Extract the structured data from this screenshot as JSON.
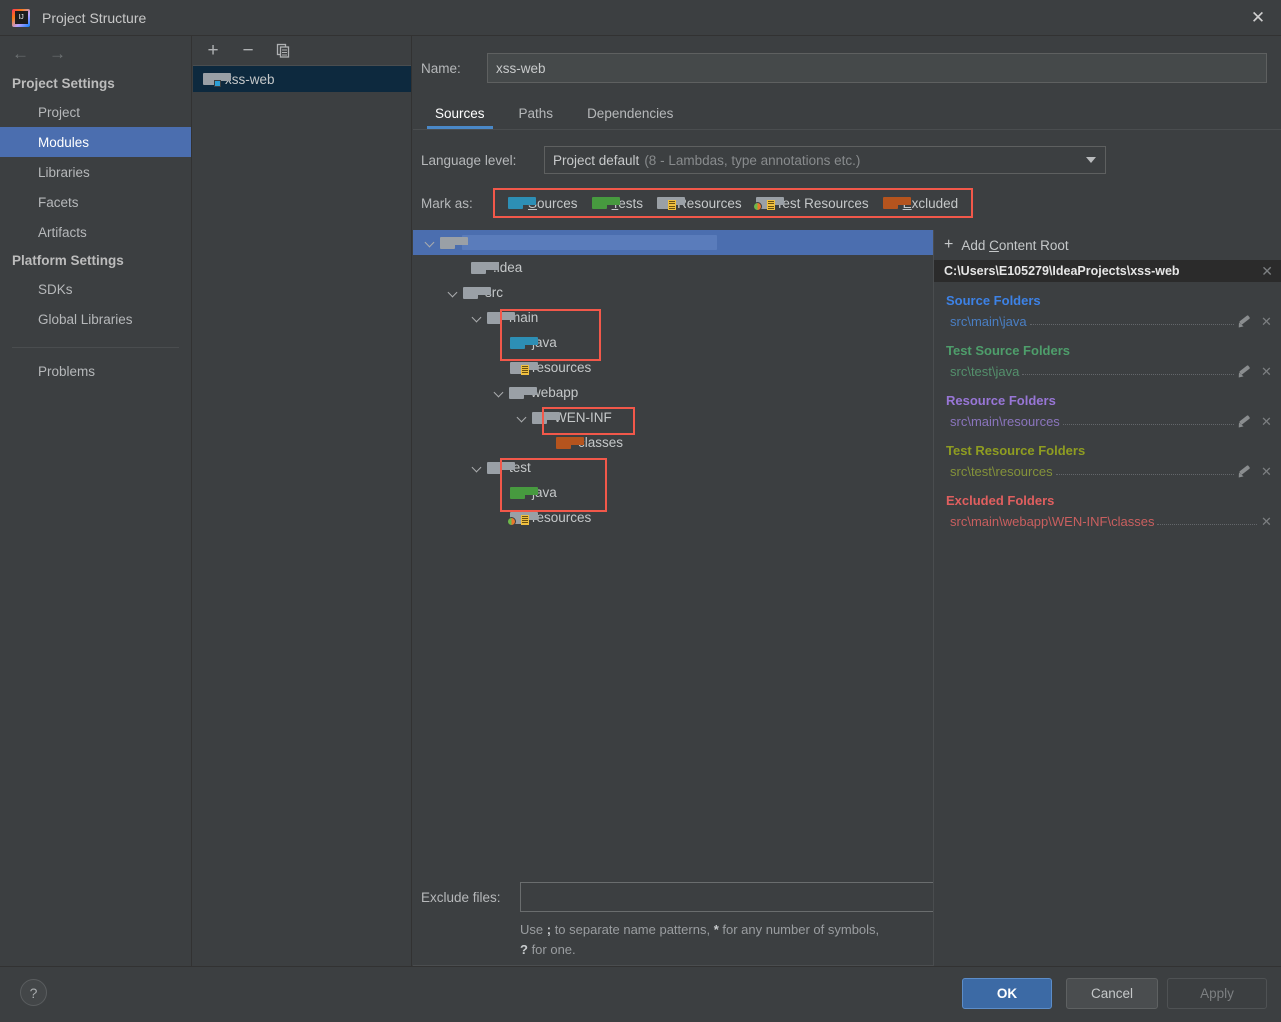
{
  "window": {
    "title": "Project Structure",
    "app_icon": "intellij-idea-icon",
    "close_label": "✕"
  },
  "sidebar": {
    "nav": {
      "back": "←",
      "forward": "→"
    },
    "groups": [
      {
        "label": "Project Settings",
        "items": [
          {
            "label": "Project",
            "selected": false
          },
          {
            "label": "Modules",
            "selected": true
          },
          {
            "label": "Libraries",
            "selected": false
          },
          {
            "label": "Facets",
            "selected": false
          },
          {
            "label": "Artifacts",
            "selected": false
          }
        ]
      },
      {
        "label": "Platform Settings",
        "items": [
          {
            "label": "SDKs",
            "selected": false
          },
          {
            "label": "Global Libraries",
            "selected": false
          }
        ]
      }
    ],
    "problems": {
      "label": "Problems"
    }
  },
  "module_list": {
    "toolbar": {
      "add": "+",
      "remove": "−",
      "copy": "copy-icon"
    },
    "items": [
      {
        "label": "xss-web",
        "icon": "module-folder-icon",
        "selected": true
      }
    ]
  },
  "editor": {
    "name_label": "Name:",
    "name_value": "xss-web",
    "tabs": [
      {
        "label": "Sources",
        "active": true
      },
      {
        "label": "Paths",
        "active": false
      },
      {
        "label": "Dependencies",
        "active": false
      }
    ],
    "language_level": {
      "label": "Language level:",
      "value": "Project default",
      "hint": "(8 - Lambdas, type annotations etc.)",
      "caret": "chevron-down-icon"
    },
    "mark_as": {
      "label": "Mark as:",
      "highlight_color": "#f2584a",
      "options": [
        {
          "label": "Sources",
          "mnemonic": "S",
          "rest": "ources",
          "icon": "folder-blue-icon"
        },
        {
          "label": "Tests",
          "mnemonic": "T",
          "rest": "ests",
          "icon": "folder-green-icon"
        },
        {
          "label": "Resources",
          "mnemonic": "",
          "rest": "Resources",
          "icon": "folder-resources-icon"
        },
        {
          "label": "Test Resources",
          "mnemonic": "",
          "rest": "Test Resources",
          "icon": "folder-test-resources-icon"
        },
        {
          "label": "Excluded",
          "mnemonic": "E",
          "rest": "xcluded",
          "icon": "folder-orange-icon"
        }
      ]
    },
    "exclude_files": {
      "label": "Exclude files:",
      "value": "",
      "hint_line1_a": "Use ",
      "hint_line1_semi": ";",
      "hint_line1_b": " to separate name patterns, ",
      "hint_line1_star": "*",
      "hint_line1_c": " for any number of symbols,",
      "hint_line2_q": "?",
      "hint_line2_b": " for one."
    }
  },
  "tree": {
    "nodes": [
      {
        "label": "",
        "depth": 0,
        "icon": "folder-gray-icon",
        "expanded": true,
        "root": true
      },
      {
        "label": ".idea",
        "depth": 1,
        "icon": "folder-gray-icon",
        "expanded": null,
        "root": false
      },
      {
        "label": "src",
        "depth": 1,
        "icon": "folder-gray-icon",
        "expanded": true,
        "root": false
      },
      {
        "label": "main",
        "depth": 2,
        "icon": "folder-gray-icon",
        "expanded": true,
        "root": false
      },
      {
        "label": "java",
        "depth": 3,
        "icon": "folder-blue-icon",
        "expanded": null,
        "root": false
      },
      {
        "label": "resources",
        "depth": 3,
        "icon": "folder-resources-icon",
        "expanded": null,
        "root": false
      },
      {
        "label": "webapp",
        "depth": 3,
        "icon": "folder-gray-icon",
        "expanded": true,
        "root": false
      },
      {
        "label": "WEN-INF",
        "depth": 4,
        "icon": "folder-gray-icon",
        "expanded": true,
        "root": false
      },
      {
        "label": "classes",
        "depth": 5,
        "icon": "folder-orange-icon",
        "expanded": null,
        "root": false
      },
      {
        "label": "test",
        "depth": 2,
        "icon": "folder-gray-icon",
        "expanded": true,
        "root": false
      },
      {
        "label": "java",
        "depth": 3,
        "icon": "folder-green-icon",
        "expanded": null,
        "root": false
      },
      {
        "label": "resources",
        "depth": 3,
        "icon": "folder-test-resources-icon",
        "expanded": null,
        "root": false
      }
    ]
  },
  "content_root": {
    "add_label_a": "Add ",
    "add_label_mnemonic": "C",
    "add_label_b": "ontent Root",
    "add_icon": "plus-icon",
    "path": "C:\\Users\\E105279\\IdeaProjects\\xss-web",
    "path_close": "✕",
    "groups": [
      {
        "title": "Source Folders",
        "color": "#3d82e6",
        "entries": [
          {
            "path": "src\\main\\java",
            "has_edit": true,
            "has_remove": true
          }
        ]
      },
      {
        "title": "Test Source Folders",
        "color": "#4e9e6b",
        "entries": [
          {
            "path": "src\\test\\java",
            "has_edit": true,
            "has_remove": true
          }
        ]
      },
      {
        "title": "Resource Folders",
        "color": "#9876d6",
        "entries": [
          {
            "path": "src\\main\\resources",
            "has_edit": true,
            "has_remove": true
          }
        ]
      },
      {
        "title": "Test Resource Folders",
        "color": "#8f9d21",
        "entries": [
          {
            "path": "src\\test\\resources",
            "has_edit": true,
            "has_remove": true
          }
        ]
      },
      {
        "title": "Excluded Folders",
        "color": "#e05f5f",
        "entries": [
          {
            "path": "src\\main\\webapp\\WEN-INF\\classes",
            "has_edit": false,
            "has_remove": true
          }
        ]
      }
    ]
  },
  "footer": {
    "help": "?",
    "ok": "OK",
    "cancel": "Cancel",
    "apply": "Apply"
  }
}
